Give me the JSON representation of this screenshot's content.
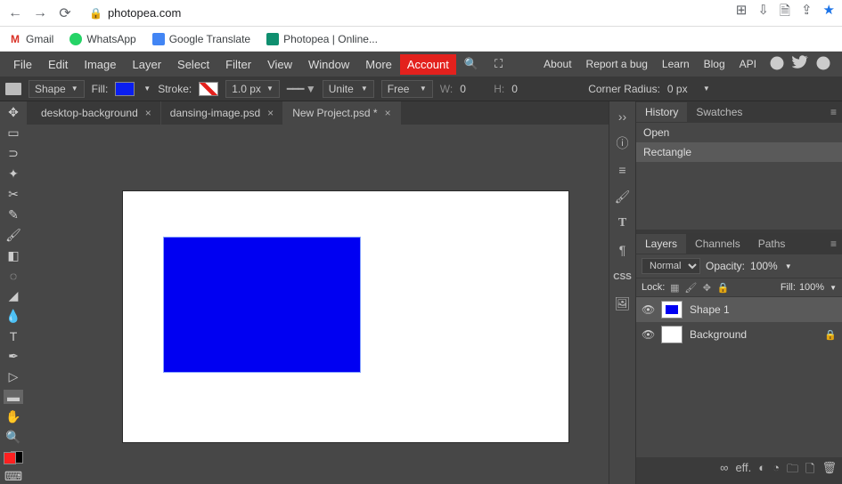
{
  "browser": {
    "url": "photopea.com",
    "bookmarks": [
      {
        "label": "Gmail",
        "icon_bg": "#fff",
        "icon_text": "M",
        "icon_color": "#d93025"
      },
      {
        "label": "WhatsApp",
        "icon_bg": "#25d366",
        "icon_text": "",
        "icon_color": "#fff"
      },
      {
        "label": "Google Translate",
        "icon_bg": "#4285f4",
        "icon_text": "",
        "icon_color": "#fff"
      },
      {
        "label": "Photopea | Online...",
        "icon_bg": "#0f8f6f",
        "icon_text": "",
        "icon_color": "#fff"
      }
    ]
  },
  "menus": [
    "File",
    "Edit",
    "Image",
    "Layer",
    "Select",
    "Filter",
    "View",
    "Window",
    "More"
  ],
  "account_label": "Account",
  "right_menus": [
    "About",
    "Report a bug",
    "Learn",
    "Blog",
    "API"
  ],
  "options": {
    "shape_label": "Shape",
    "fill_label": "Fill:",
    "fill_color": "#0a1ef0",
    "stroke_label": "Stroke:",
    "stroke_width": "1.0 px",
    "combine": "Unite",
    "align": "Free",
    "w_label": "W:",
    "w_value": "0",
    "h_label": "H:",
    "h_value": "0",
    "corner_label": "Corner Radius:",
    "corner_value": "0 px"
  },
  "tabs": [
    {
      "label": "desktop-background",
      "active": false
    },
    {
      "label": "dansing-image.psd",
      "active": false
    },
    {
      "label": "New Project.psd *",
      "active": true
    }
  ],
  "history": {
    "tabs": [
      "History",
      "Swatches"
    ],
    "items": [
      "Open",
      "Rectangle"
    ],
    "selected": 1
  },
  "layers_panel": {
    "tabs": [
      "Layers",
      "Channels",
      "Paths"
    ],
    "blend": "Normal",
    "opacity_label": "Opacity:",
    "opacity_value": "100%",
    "lock_label": "Lock:",
    "fill_label": "Fill:",
    "fill_value": "100%",
    "layers": [
      {
        "name": "Shape 1",
        "thumb": "blue",
        "active": true,
        "locked": false
      },
      {
        "name": "Background",
        "thumb": "white",
        "active": false,
        "locked": true
      }
    ]
  }
}
